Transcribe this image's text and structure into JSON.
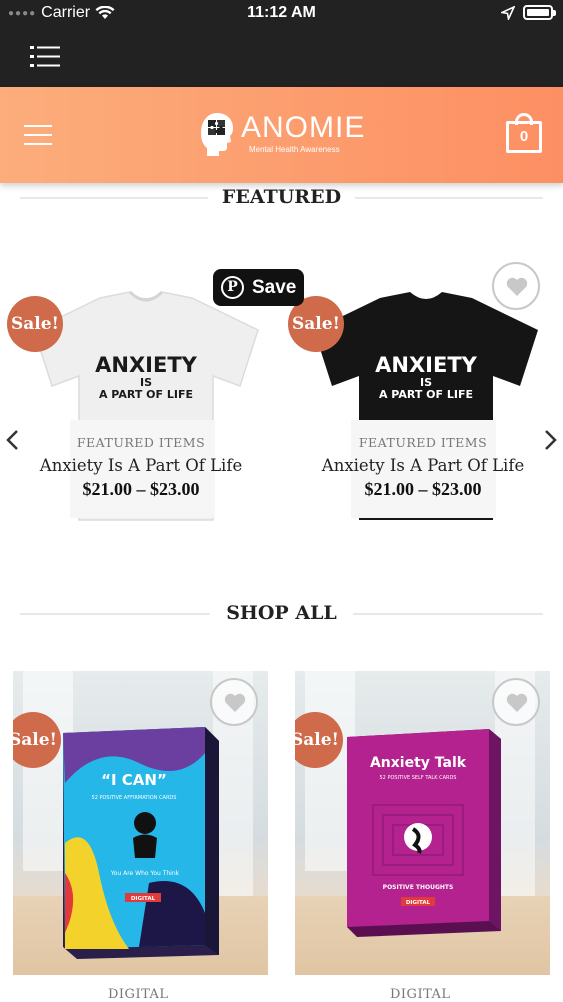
{
  "status_bar": {
    "carrier": "Carrier",
    "time": "11:12 AM"
  },
  "header": {
    "brand": "ANOMIE",
    "tagline": "Mental Health Awareness",
    "cart_count": "0",
    "gradient_start": "#fcad7b",
    "gradient_end": "#fd8f63"
  },
  "featured": {
    "title": "FEATURED",
    "pin_save_label": "Save",
    "products": [
      {
        "sale_label": "Sale!",
        "shirt_text_1": "ANXIETY",
        "shirt_text_2": "IS",
        "shirt_text_3": "A PART OF LIFE",
        "shirt_color": "white",
        "category": "FEATURED ITEMS",
        "name": "Anxiety Is A Part Of Life",
        "price": "$21.00 – $23.00"
      },
      {
        "sale_label": "Sale!",
        "shirt_text_1": "ANXIETY",
        "shirt_text_2": "IS",
        "shirt_text_3": "A PART OF LIFE",
        "shirt_color": "black",
        "category": "FEATURED ITEMS",
        "name": "Anxiety Is A Part Of Life",
        "price": "$21.00 – $23.00"
      }
    ]
  },
  "shop_all": {
    "title": "SHOP ALL",
    "products": [
      {
        "sale_label": "Sale!",
        "box_title": "“I CAN”",
        "box_sub": "52 POSITIVE AFFIRMATION CARDS",
        "box_note": "You Are Who You Think",
        "box_badge": "DIGITAL",
        "category": "DIGITAL"
      },
      {
        "sale_label": "Sale!",
        "box_title": "Anxiety Talk",
        "box_sub": "52 POSITIVE SELF TALK CARDS",
        "box_note": "POSITIVE THOUGHTS",
        "box_badge": "DIGITAL",
        "category": "DIGITAL"
      }
    ]
  },
  "colors": {
    "sale_badge": "#cf6a4a",
    "top_bar": "#222222"
  }
}
